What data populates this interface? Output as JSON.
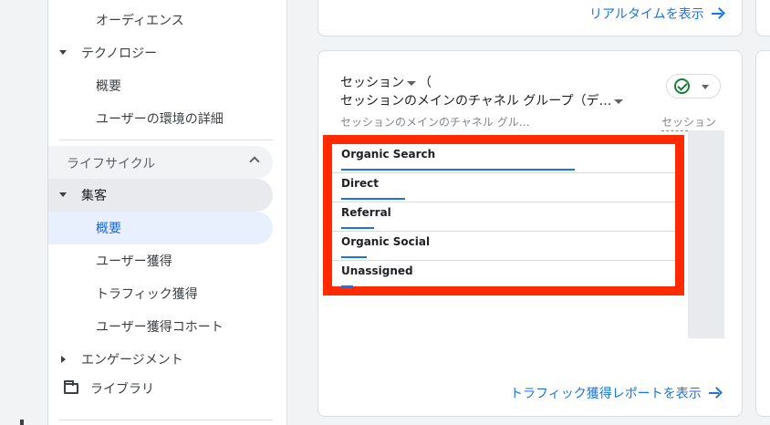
{
  "sidebar": {
    "items": [
      {
        "label": "オーディエンス"
      },
      {
        "label": "テクノロジー"
      },
      {
        "label": "概要"
      },
      {
        "label": "ユーザーの環境の詳細"
      },
      {
        "label": "ライフサイクル"
      },
      {
        "label": "集客"
      },
      {
        "label": "概要"
      },
      {
        "label": "ユーザー獲得"
      },
      {
        "label": "トラフィック獲得"
      },
      {
        "label": "ユーザー獲得コホート"
      },
      {
        "label": "エンゲージメント"
      },
      {
        "label": "ライブラリ"
      }
    ]
  },
  "top_card": {
    "link_label": "リアルタイムを表示"
  },
  "card": {
    "title_line1": "セッション",
    "title_suffix": "（",
    "title_line2": "セッションのメインのチャネル グループ（デ…",
    "column_left": "セッションのメインのチャネル グル…",
    "column_right": "セッション",
    "rows": [
      {
        "label": "Organic Search",
        "bar_fraction": 0.68
      },
      {
        "label": "Direct",
        "bar_fraction": 0.185
      },
      {
        "label": "Referral",
        "bar_fraction": 0.095
      },
      {
        "label": "Organic Social",
        "bar_fraction": 0.075
      },
      {
        "label": "Unassigned",
        "bar_fraction": 0.035
      }
    ],
    "footer_link": "トラフィック獲得レポートを表示"
  },
  "colors": {
    "accent": "#1a73e8",
    "highlight": "#ff2a00",
    "success": "#188038"
  }
}
